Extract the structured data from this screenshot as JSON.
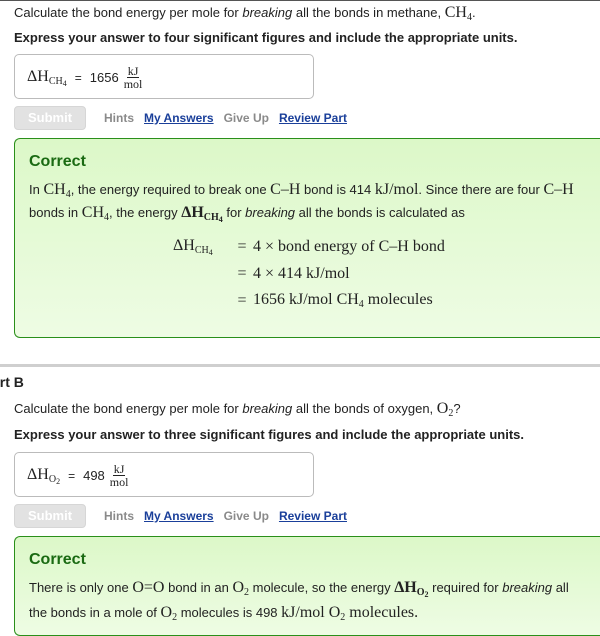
{
  "partA": {
    "question_pre": "Calculate the bond energy per mole for ",
    "question_em": "breaking",
    "question_post": " all the bonds in methane, ",
    "question_formula": "CH",
    "question_formula_sub": "4",
    "question_end": ".",
    "instruction": "Express your answer to four significant figures and include the appropriate units.",
    "answer": {
      "symbol": "ΔH",
      "symbol_sub": "CH",
      "symbol_sub_sub": "4",
      "equals": "=",
      "value": "1656",
      "unit_num": "kJ",
      "unit_den": "mol"
    },
    "actions": {
      "submit": "Submit",
      "hints": "Hints",
      "my_answers": "My Answers",
      "give_up": "Give Up",
      "review_part": "Review Part"
    },
    "feedback": {
      "title": "Correct",
      "line1_a": "In ",
      "line1_ch": "CH",
      "line1_ch_sub": "4",
      "line1_b": ", the energy required to break one ",
      "line1_bond": "C–H",
      "line1_c": " bond is 414 ",
      "line1_unit": "kJ/mol",
      "line1_d": ". Since there are four ",
      "line1_bond2": "C–H",
      "line2_a": "bonds in ",
      "line2_ch": "CH",
      "line2_ch_sub": "4",
      "line2_b": ", the energy ",
      "line2_sym": "ΔH",
      "line2_sym_sub": "CH",
      "line2_sym_sub_sub": "4",
      "line2_c": " for ",
      "line2_em": "breaking",
      "line2_d": " all the bonds is calculated as",
      "equation": {
        "lhs": "ΔH",
        "lhs_sub": "CH",
        "lhs_sub_sub": "4",
        "rows": [
          {
            "eq": "=",
            "rhs": "4 × bond energy of C–H bond"
          },
          {
            "eq": "=",
            "rhs": "4 × 414 kJ/mol"
          },
          {
            "eq": "=",
            "rhs_a": "1656 kJ/mol CH",
            "rhs_sub": "4",
            "rhs_b": " molecules"
          }
        ]
      }
    }
  },
  "partB": {
    "heading": "art B",
    "question_pre": "Calculate the bond energy per mole for ",
    "question_em": "breaking",
    "question_post": " all the bonds of oxygen, ",
    "question_formula": "O",
    "question_formula_sub": "2",
    "question_end": "?",
    "instruction": "Express your answer to three significant figures and include the appropriate units.",
    "answer": {
      "symbol": "ΔH",
      "symbol_sub": "O",
      "symbol_sub_sub": "2",
      "equals": "=",
      "value": "498",
      "unit_num": "kJ",
      "unit_den": "mol"
    },
    "actions": {
      "submit": "Submit",
      "hints": "Hints",
      "my_answers": "My Answers",
      "give_up": "Give Up",
      "review_part": "Review Part"
    },
    "feedback": {
      "title": "Correct",
      "line1_a": "There is only one ",
      "line1_bond": "O=O",
      "line1_b": " bond in an ",
      "line1_o2": "O",
      "line1_o2_sub": "2",
      "line1_c": " molecule, so the energy ",
      "line1_sym": "ΔH",
      "line1_sym_sub": "O",
      "line1_sym_sub_sub": "2",
      "line1_d": " required for ",
      "line1_em": "breaking",
      "line1_e": " all",
      "line2_a": "the bonds in a mole of ",
      "line2_o2": "O",
      "line2_o2_sub": "2",
      "line2_b": " molecules is 498 ",
      "line2_unit": "kJ/mol O",
      "line2_unit_sub": "2",
      "line2_c": " molecules."
    }
  },
  "colors": {
    "correct_title": "#1a6a12",
    "feedback_border": "#2a8f1a",
    "link": "#1a3f9a",
    "disabled_text": "#8a8a8a"
  }
}
